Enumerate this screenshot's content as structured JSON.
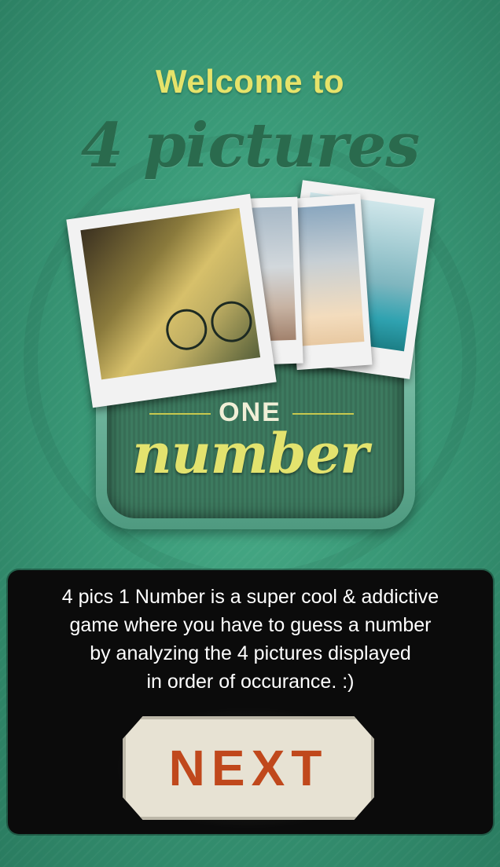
{
  "welcome": {
    "line1": "Welcome to",
    "title": "4 pictures"
  },
  "logo": {
    "one": "ONE",
    "number": "number"
  },
  "description": {
    "lines": [
      "4 pics 1 Number is a super cool & addictive",
      "game where you have to guess a number",
      "by analyzing the 4 pictures displayed",
      "in order of occurance.  :)"
    ]
  },
  "next_button": {
    "label": "NEXT"
  },
  "colors": {
    "title_yellow": "#e6e36a",
    "title_green": "#2a6a4d",
    "next_text": "#c0481c",
    "next_bg": "#e7e2d3",
    "panel_bg": "#0b0b0b"
  }
}
